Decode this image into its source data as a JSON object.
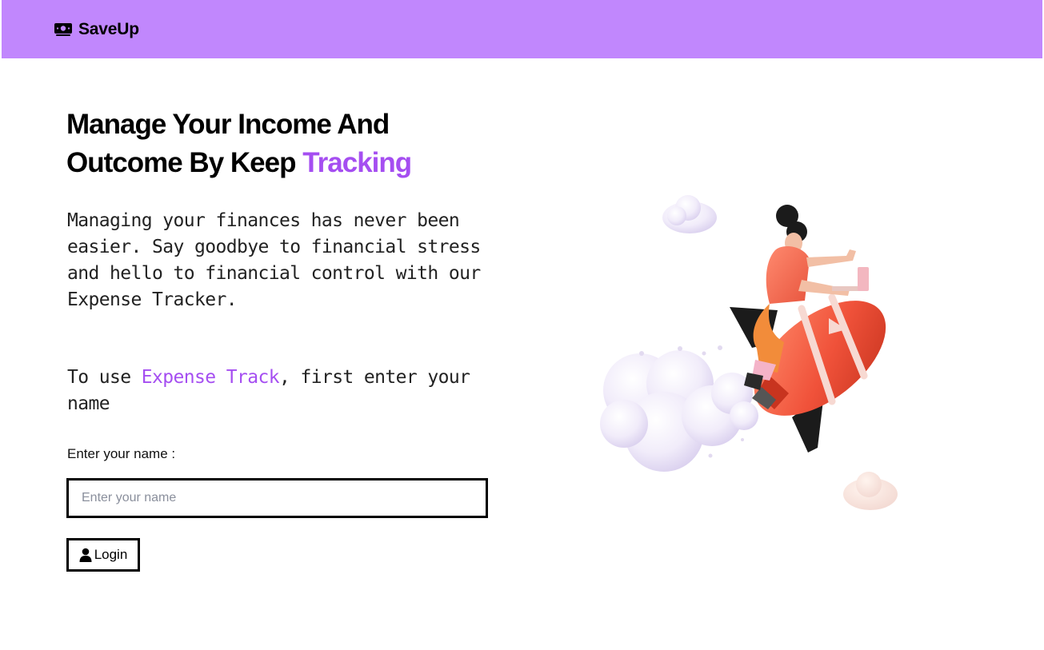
{
  "navbar": {
    "brand_name": "SaveUp",
    "brand_icon": "money-bill-icon",
    "background": "#c187fd"
  },
  "hero": {
    "title_line1": "Manage Your Income And",
    "title_line2_prefix": "Outcome By Keep ",
    "title_line2_accent": "Tracking",
    "description": "Managing your finances has never been easier. Say goodbye to financial stress and hello to financial control with our Expense Tracker.",
    "instruction_prefix": "To use ",
    "instruction_accent": "Expense Track",
    "instruction_suffix": ", first enter your name",
    "accent_color": "#a54ef1"
  },
  "form": {
    "label": "Enter your name :",
    "input_placeholder": "Enter your name",
    "input_value": "",
    "login_label": "Login",
    "login_icon": "user-icon"
  },
  "illustration": {
    "subject": "rocket-illustration"
  }
}
